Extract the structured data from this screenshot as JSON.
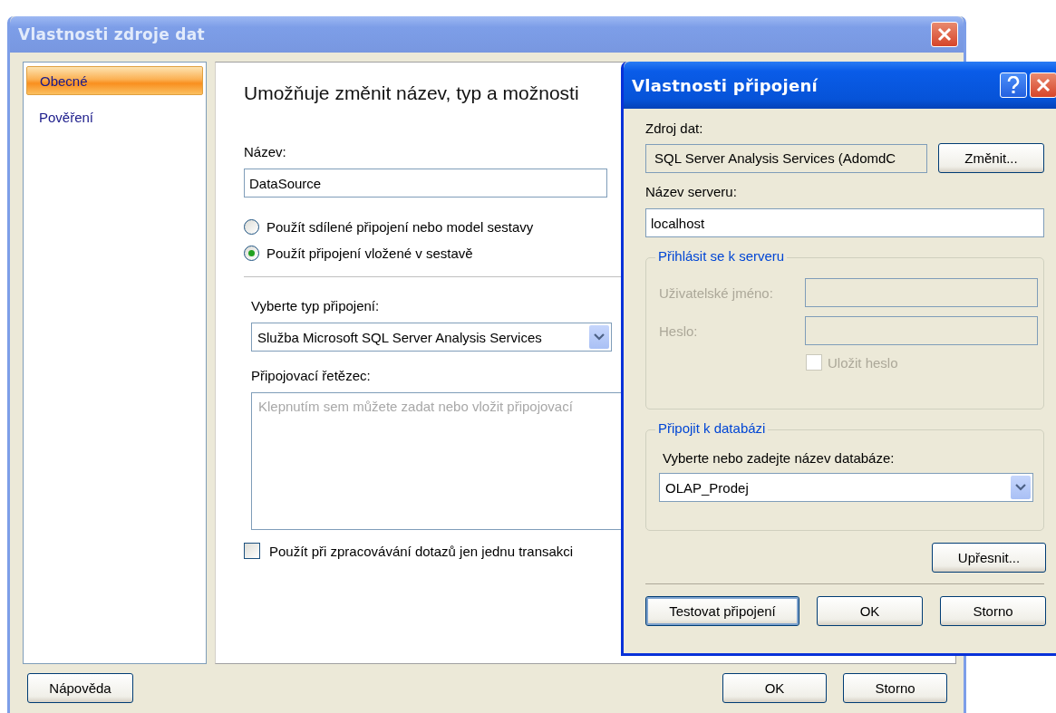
{
  "window": {
    "title": "Vlastnosti zdroje dat",
    "sidebar": {
      "items": [
        {
          "label": "Obecné",
          "selected": true
        },
        {
          "label": "Pověření",
          "selected": false
        }
      ]
    },
    "heading": "Umožňuje změnit název, typ a možnosti",
    "name": {
      "label": "Název:",
      "value": "DataSource"
    },
    "radios": [
      {
        "label": "Použít sdílené připojení nebo model sestavy",
        "selected": false
      },
      {
        "label": "Použít připojení vložené v sestavě",
        "selected": true
      }
    ],
    "connection_type": {
      "label": "Vyberte typ připojení:",
      "value": "Služba Microsoft SQL Server Analysis Services"
    },
    "connection_string": {
      "label": "Připojovací řetězec:",
      "placeholder": "Klepnutím sem můžete zadat nebo vložit připojovací"
    },
    "single_transaction": {
      "label": "Použít při zpracovávání dotazů jen jednu transakci",
      "checked": false
    },
    "help_button": "Nápověda",
    "buttons": [
      "OK",
      "Storno"
    ]
  },
  "dialog": {
    "title": "Vlastnosti připojení",
    "source": {
      "label": "Zdroj dat:",
      "value": "SQL Server Analysis Services (AdomdC",
      "button": "Změnit..."
    },
    "server": {
      "label": "Název serveru:",
      "value": "localhost"
    },
    "login": {
      "title": "Přihlásit se k serveru",
      "disabled": true,
      "user_label": "Uživatelské jméno:",
      "password_label": "Heslo:",
      "save_password": {
        "label": "Uložit heslo",
        "checked": false
      }
    },
    "database": {
      "title": "Připojit k databázi",
      "label": "Vyberte nebo zadejte název databáze:",
      "value": "OLAP_Prodej"
    },
    "advanced_button": "Upřesnit...",
    "buttons": [
      {
        "label": "Testovat připojení",
        "focused": true
      },
      {
        "label": "OK",
        "focused": false
      },
      {
        "label": "Storno",
        "focused": false
      }
    ]
  }
}
